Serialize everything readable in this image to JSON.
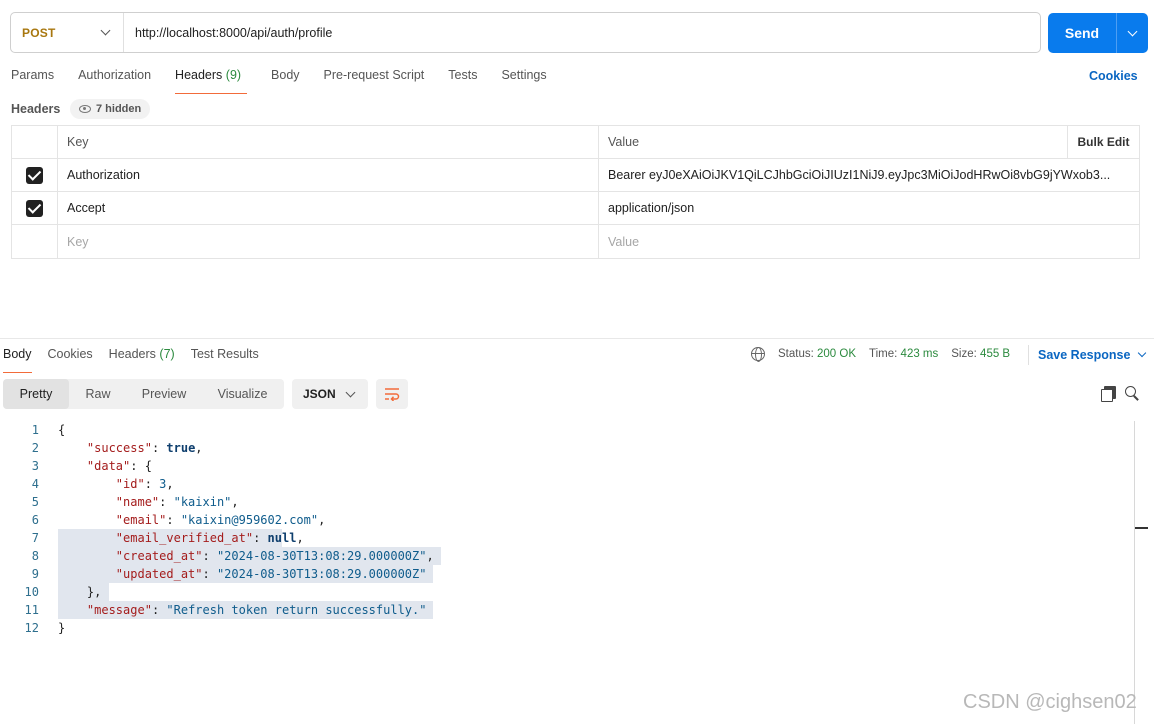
{
  "request": {
    "method": "POST",
    "url": "http://localhost:8000/api/auth/profile",
    "send_label": "Send"
  },
  "request_tabs": [
    {
      "label": "Params"
    },
    {
      "label": "Authorization"
    },
    {
      "label": "Headers",
      "count": "(9)"
    },
    {
      "label": "Body"
    },
    {
      "label": "Pre-request Script"
    },
    {
      "label": "Tests"
    },
    {
      "label": "Settings"
    }
  ],
  "cookies_link": "Cookies",
  "headers_section": {
    "label": "Headers",
    "hidden_label": "7 hidden",
    "columns": {
      "key": "Key",
      "value": "Value",
      "bulk_edit": "Bulk Edit"
    },
    "rows": [
      {
        "key": "Authorization",
        "value": "Bearer eyJ0eXAiOiJKV1QiLCJhbGciOiJIUzI1NiJ9.eyJpc3MiOiJodHRwOi8vbG9jYWxob3..."
      },
      {
        "key": "Accept",
        "value": "application/json"
      }
    ],
    "placeholder_key": "Key",
    "placeholder_value": "Value"
  },
  "response_tabs": [
    {
      "label": "Body"
    },
    {
      "label": "Cookies"
    },
    {
      "label": "Headers",
      "count": "(7)"
    },
    {
      "label": "Test Results"
    }
  ],
  "status": {
    "status_label": "Status:",
    "status_value": "200 OK",
    "time_label": "Time:",
    "time_value": "423 ms",
    "size_label": "Size:",
    "size_value": "455 B"
  },
  "save_response": "Save Response",
  "view_modes": [
    "Pretty",
    "Raw",
    "Preview",
    "Visualize"
  ],
  "format": "JSON",
  "code_lines": [
    "{",
    "    \"success\": true,",
    "    \"data\": {",
    "        \"id\": 3,",
    "        \"name\": \"kaixin\",",
    "        \"email\": \"kaixin@959602.com\",",
    "        \"email_verified_at\": null,",
    "        \"created_at\": \"2024-08-30T13:08:29.000000Z\",",
    "        \"updated_at\": \"2024-08-30T13:08:29.000000Z\"",
    "    },",
    "    \"message\": \"Refresh token return successfully.\"",
    "}"
  ],
  "watermark": "CSDN @cighsen02",
  "colors": {
    "send": "#097bed",
    "method": "#a8770f",
    "status_ok": "#2b8a3e",
    "active_tab": "#f26b3a",
    "link": "#0a66c2"
  }
}
